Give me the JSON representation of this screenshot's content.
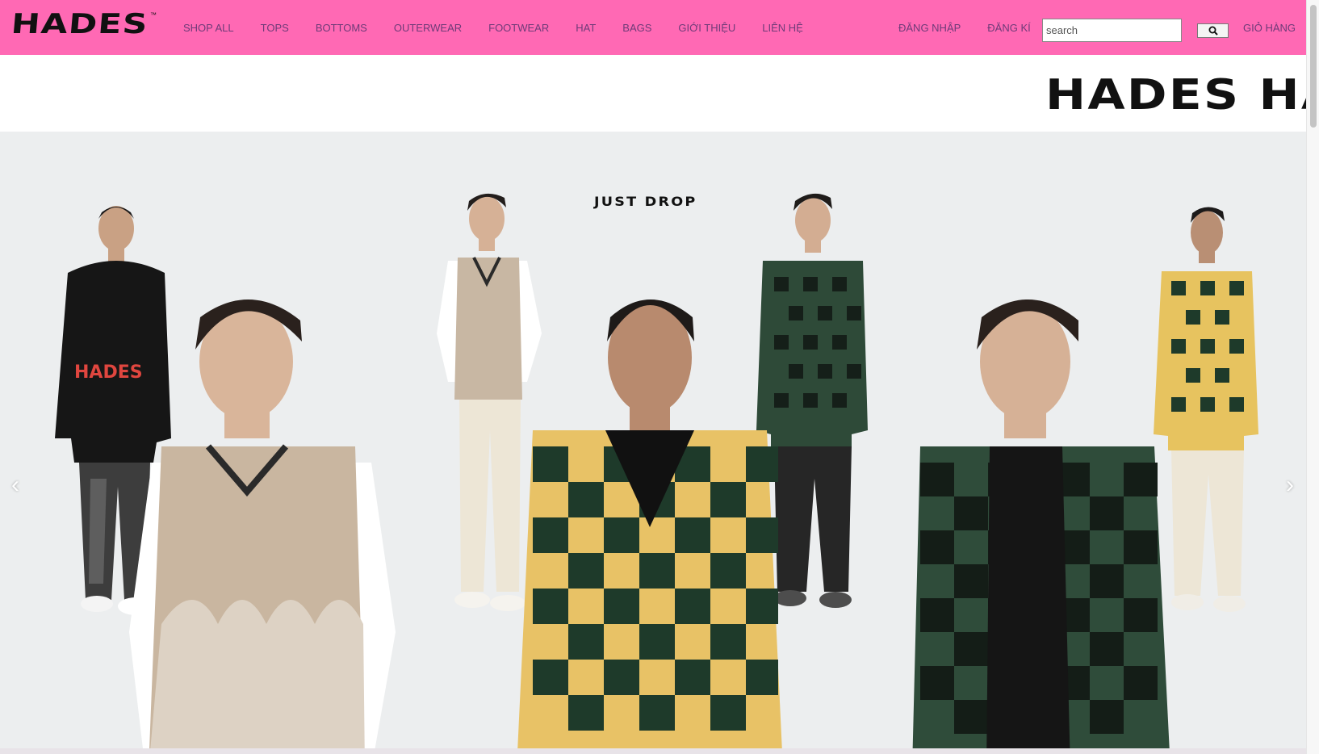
{
  "brand": {
    "logo": "HADES",
    "tm": "™"
  },
  "nav": {
    "links": [
      "SHOP ALL",
      "TOPS",
      "BOTTOMS",
      "OUTERWEAR",
      "FOOTWEAR",
      "HAT",
      "BAGS",
      "GIỚI THIỆU",
      "LIÊN HỆ"
    ],
    "login": "ĐĂNG NHẬP",
    "register": "ĐĂNG KÍ",
    "search_placeholder": "search",
    "search_icon": "search-icon",
    "cart": "GIỎ HÀNG"
  },
  "marquee": {
    "text": "HADES HADES"
  },
  "hero": {
    "heading": "JUST DROP",
    "prev_icon": "chevron-left-icon",
    "next_icon": "chevron-right-icon",
    "prev_glyph": "‹",
    "next_glyph": "›",
    "hoodie_print": "HADES"
  },
  "colors": {
    "header_bg": "#ff69b4",
    "nav_text": "#6e3b78",
    "hero_bg": "#eceeef"
  }
}
